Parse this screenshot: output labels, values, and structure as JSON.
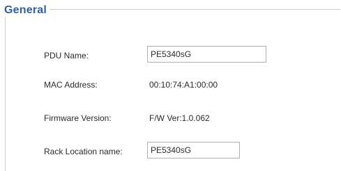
{
  "section": {
    "title": "General"
  },
  "fields": {
    "pdu_name": {
      "label": "PDU Name:",
      "value": "PE5340sG"
    },
    "mac_address": {
      "label": "MAC Address:",
      "value": "00:10:74:A1:00:00"
    },
    "firmware_version": {
      "label": "Firmware Version:",
      "value": "F/W Ver:1.0.062"
    },
    "rack_location_name": {
      "label": "Rack Location name:",
      "value": "PE5340sG"
    }
  }
}
